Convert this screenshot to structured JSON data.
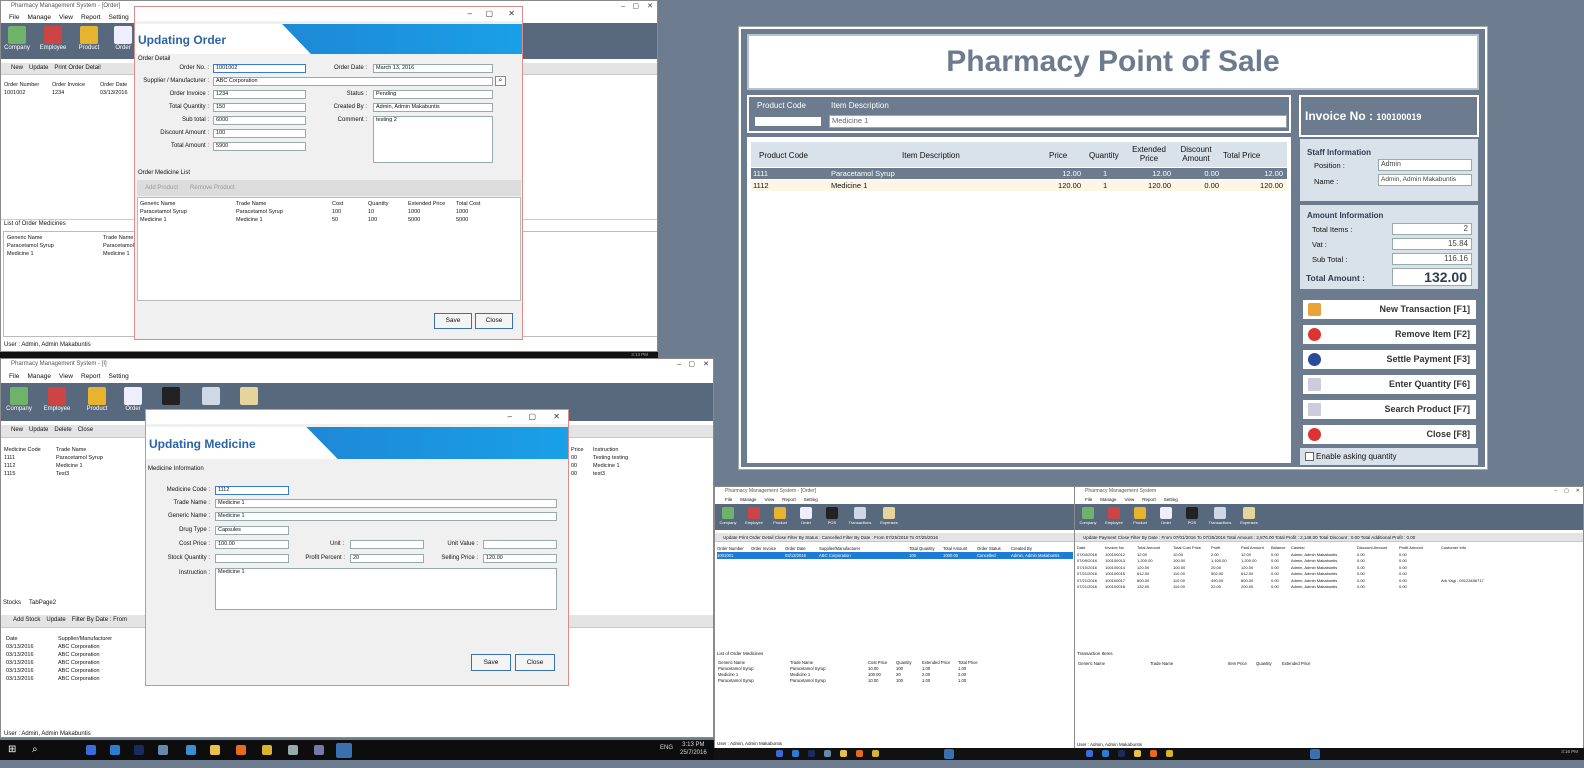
{
  "win1": {
    "title": "Pharmacy Management System - [Order]",
    "menu": [
      "File",
      "Manage",
      "View",
      "Report",
      "Setting"
    ],
    "ribbon": [
      "Company",
      "Employee",
      "Product",
      "Order"
    ],
    "toolbar": {
      "new": "New",
      "update": "Update",
      "print": "Print Order Detail"
    },
    "list_headers": [
      "Order Number",
      "Order Invoice",
      "Order Date"
    ],
    "list_row": [
      "1001002",
      "1234",
      "03/13/2016"
    ],
    "medicines_caption": "List of Order Medicines",
    "medicines_headers": [
      "Generic Name",
      "Trade Name"
    ],
    "medicines_rows": [
      [
        "Paracetamol Syrup",
        "Paracetamol"
      ],
      [
        "Medicine 1",
        "Medicine 1"
      ]
    ],
    "status": "User :  Admin, Admin Makabuntis"
  },
  "order_dialog": {
    "title": "Updating Order",
    "section": "Order Detail",
    "order_no_label": "Order No. :",
    "order_no": "1001002",
    "order_date_label": "Order Date :",
    "order_date": "March    13, 2016",
    "supplier_label": "Supplier / Manufacturer :",
    "supplier": "ABC Corporation",
    "invoice_label": "Order Invoice :",
    "invoice": "1234",
    "status_label": "Status :",
    "status": "Pending",
    "total_qty_label": "Total Quantity :",
    "total_qty": "150",
    "created_by_label": "Created By :",
    "created_by": "Admin, Admin Makabuntis",
    "subtotal_label": "Sub total :",
    "subtotal": "6000",
    "comment_label": "Comment :",
    "comment": "testing 2",
    "discount_label": "Discount Amount :",
    "discount": "100",
    "total_label": "Total Amount :",
    "total": "5900",
    "list_caption": "Order Medicine List",
    "add_product": "Add Product",
    "remove_product": "Remove Product",
    "headers": [
      "Generic Name",
      "Trade Name",
      "Cost",
      "Quantity",
      "Extended Price",
      "Total Cost"
    ],
    "rows": [
      [
        "Paracetamol Syrup",
        "Paracetamol Syrup",
        "100",
        "10",
        "1000",
        "1000"
      ],
      [
        "Medicine 1",
        "Medicine 1",
        "50",
        "100",
        "5000",
        "5000"
      ]
    ],
    "save": "Save",
    "close": "Close"
  },
  "win2": {
    "title": "Pharmacy Management System - [I]",
    "menu": [
      "File",
      "Manage",
      "View",
      "Report",
      "Setting"
    ],
    "ribbon": [
      "Company",
      "Employee",
      "Product",
      "Order"
    ],
    "toolbar": {
      "new": "New",
      "update": "Update",
      "delete": "Delete",
      "close": "Close"
    },
    "headers": [
      "Medicine Code",
      "Trade Name"
    ],
    "rows": [
      [
        "1111",
        "Paracetamol Syrup"
      ],
      [
        "1112",
        "Medicine 1"
      ],
      [
        "1115",
        "Test3"
      ]
    ],
    "right_headers": [
      "Price",
      "Instruction"
    ],
    "right_rows": [
      [
        "00",
        "Testing testing"
      ],
      [
        "00",
        "Medicine 1"
      ],
      [
        "00",
        "test3"
      ]
    ],
    "tabs": [
      "Stocks",
      "TabPage2"
    ],
    "stock_toolbar": {
      "add": "Add Stock",
      "update": "Update",
      "filter": "Filter By Date : From"
    },
    "stock_headers": [
      "Date",
      "Supplier/Manufacturer"
    ],
    "stock_rows": [
      [
        "03/13/2016",
        "ABC Corporation"
      ],
      [
        "03/13/2016",
        "ABC Corporation"
      ],
      [
        "03/13/2016",
        "ABC Corporation"
      ],
      [
        "03/13/2016",
        "ABC Corporation"
      ],
      [
        "03/13/2016",
        "ABC Corporation"
      ]
    ],
    "status": "User :  Admin, Admin Makabuntis"
  },
  "medicine_dialog": {
    "title": "Updating Medicine",
    "section": "Medicine Information",
    "code_label": "Medicine Code :",
    "code": "1112",
    "trade_label": "Trade Name :",
    "trade": "Medicine 1",
    "generic_label": "Generic Name :",
    "generic": "Medicine 1",
    "drug_label": "Drug Type :",
    "drug": "Capsules",
    "cost_label": "Cost Price :",
    "cost": "100.00",
    "unit_label": "Unit :",
    "unit": "",
    "unit_value_label": "Unit Value :",
    "unit_value": "",
    "stock_label": "Stock Quantity :",
    "stock": "",
    "profit_label": "Profit Percent :",
    "profit": "20",
    "selling_label": "Selling Price :",
    "selling": "120.00",
    "instruction_label": "Instruction :",
    "instruction": "Medicine 1",
    "save": "Save",
    "close": "Close"
  },
  "pos": {
    "title": "Pharmacy Point of Sale",
    "code_header": "Product Code",
    "desc_header": "Item Description",
    "code_value": "",
    "desc_value": "Medicine 1",
    "invoice_label": "Invoice No :",
    "invoice_no": "100100019",
    "grid_headers": [
      "Product Code",
      "Item Description",
      "Price",
      "Quantity",
      "Extended Price",
      "Discount Amount",
      "Total Price"
    ],
    "grid_rows": [
      [
        "1111",
        "Paracetamol Syrup",
        "12.00",
        "1",
        "12.00",
        "0.00",
        "12.00"
      ],
      [
        "1112",
        "Medicine 1",
        "120.00",
        "1",
        "120.00",
        "0.00",
        "120.00"
      ]
    ],
    "staff_header": "Staff Information",
    "position_label": "Position :",
    "position": "Admin",
    "name_label": "Name :",
    "name": "Admin, Admin Makabuntis",
    "amount_header": "Amount Information",
    "total_items_label": "Total Items :",
    "total_items": "2",
    "vat_label": "Vat :",
    "vat": "15.84",
    "subtotal_label": "Sub Total :",
    "subtotal": "116.16",
    "total_amount_label": "Total Amount :",
    "total_amount": "132.00",
    "buttons": [
      "New Transaction [F1]",
      "Remove Item [F2]",
      "Settle Payment [F3]",
      "Enter Quantity [F6]",
      "Search Product [F7]",
      "Close [F8]"
    ],
    "enable_qty": "Enable asking quantity"
  },
  "win3": {
    "title": "Pharmacy Management System - [Order]",
    "ribbon": [
      "Company",
      "Employee",
      "Product",
      "Order",
      "POS",
      "Transactions",
      "Expenses"
    ],
    "toolbar": "Update   Print Order Detail   Close   Filter By Status : Cancelled   Filter By Date : From 07/25/2016  To 07/25/2016",
    "headers": [
      "Order Number",
      "Order Invoice",
      "Order Date",
      "Supplier/Manufacturer",
      "Total Quantity",
      "Total Amount",
      "Order Status",
      "Created By"
    ],
    "row": [
      "1001001",
      "",
      "03/13/2016",
      "ABC Corporation",
      "100",
      "1000.00",
      "Cancelled",
      "Admin, Admin Makabuntis"
    ],
    "caption": "List of Order Medicines",
    "med_headers": [
      "Generic Name",
      "Trade Name",
      "Cost Price",
      "Quantity",
      "Extended Price",
      "Total Price"
    ],
    "med_rows": [
      [
        "Paracetamol Syrup",
        "Paracetamol Syrup",
        "10.00",
        "100",
        "1.00",
        "1.00"
      ],
      [
        "Medicine 1",
        "Medicine 1",
        "100.00",
        "20",
        "2.00",
        "2.00"
      ],
      [
        "Paracetamol Syrup",
        "Paracetamol Syrup",
        "10.00",
        "100",
        "1.00",
        "1.00"
      ]
    ],
    "status": "User :  Admin, Admin Makabuntis"
  },
  "win4": {
    "title": "Pharmacy Management System",
    "ribbon": [
      "Company",
      "Employee",
      "Product",
      "Order",
      "POS",
      "Transactions",
      "Expenses"
    ],
    "toolbar": "Update Payment   Close   Filter By Date : From 07/01/2016  To 07/25/2016   Total Amount : 2,876.00   Total Profit : 2,148.00   Total Discount : 0.00   Total Additional Profit : 0.00",
    "headers": [
      "Date",
      "Invoice No",
      "Total Amount",
      "Total Cost Price",
      "Profit",
      "Paid Amount",
      "Balance",
      "Cashier",
      "Discount Amount",
      "Profit Amount",
      "Customer Info"
    ],
    "rows": [
      [
        "07/04/2016",
        "100100012",
        "12.00",
        "10.00",
        "2.00",
        "12.00",
        "0.00",
        "Admin, Admin Makabuntis",
        "0.00",
        "0.00",
        ""
      ],
      [
        "07/09/2016",
        "100100013",
        "1,200.00",
        "100.00",
        "1,100.00",
        "1,200.00",
        "0.00",
        "Admin, Admin Makabuntis",
        "0.00",
        "0.00",
        ""
      ],
      [
        "07/10/2016",
        "100100014",
        "120.00",
        "100.00",
        "20.00",
        "120.00",
        "0.00",
        "Admin, Admin Makabuntis",
        "0.00",
        "0.00",
        ""
      ],
      [
        "07/21/2016",
        "100100015",
        "612.00",
        "110.00",
        "502.00",
        "612.00",
        "0.00",
        "Admin, Admin Makabuntis",
        "0.00",
        "0.00",
        ""
      ],
      [
        "07/21/2016",
        "100100017",
        "600.00",
        "110.00",
        "490.00",
        "600.00",
        "0.00",
        "Admin, Admin Makabuntis",
        "0.00",
        "0.00",
        "Ark Yagi - 09123456717"
      ],
      [
        "07/21/2016",
        "100100018",
        "132.00",
        "110.00",
        "22.00",
        "200.00",
        "0.00",
        "Admin, Admin Makabuntis",
        "0.00",
        "0.00",
        ""
      ]
    ],
    "caption": "Transaction Items",
    "item_headers": [
      "Generic Name",
      "Trade Name",
      "Item Price",
      "Quantity",
      "Extended Price"
    ],
    "status": "User :  Admin, Admin Makabuntis"
  },
  "taskbar": {
    "lang": "ENG",
    "time": "3:13 PM",
    "date": "25/7/2016",
    "time_top": "3:13 PM",
    "time_small": "3:16 PM"
  },
  "colors": {
    "pos_gray": "#6c7c8e",
    "accent_blue": "#1e88d6",
    "selected_row": "#1c7cd6"
  }
}
